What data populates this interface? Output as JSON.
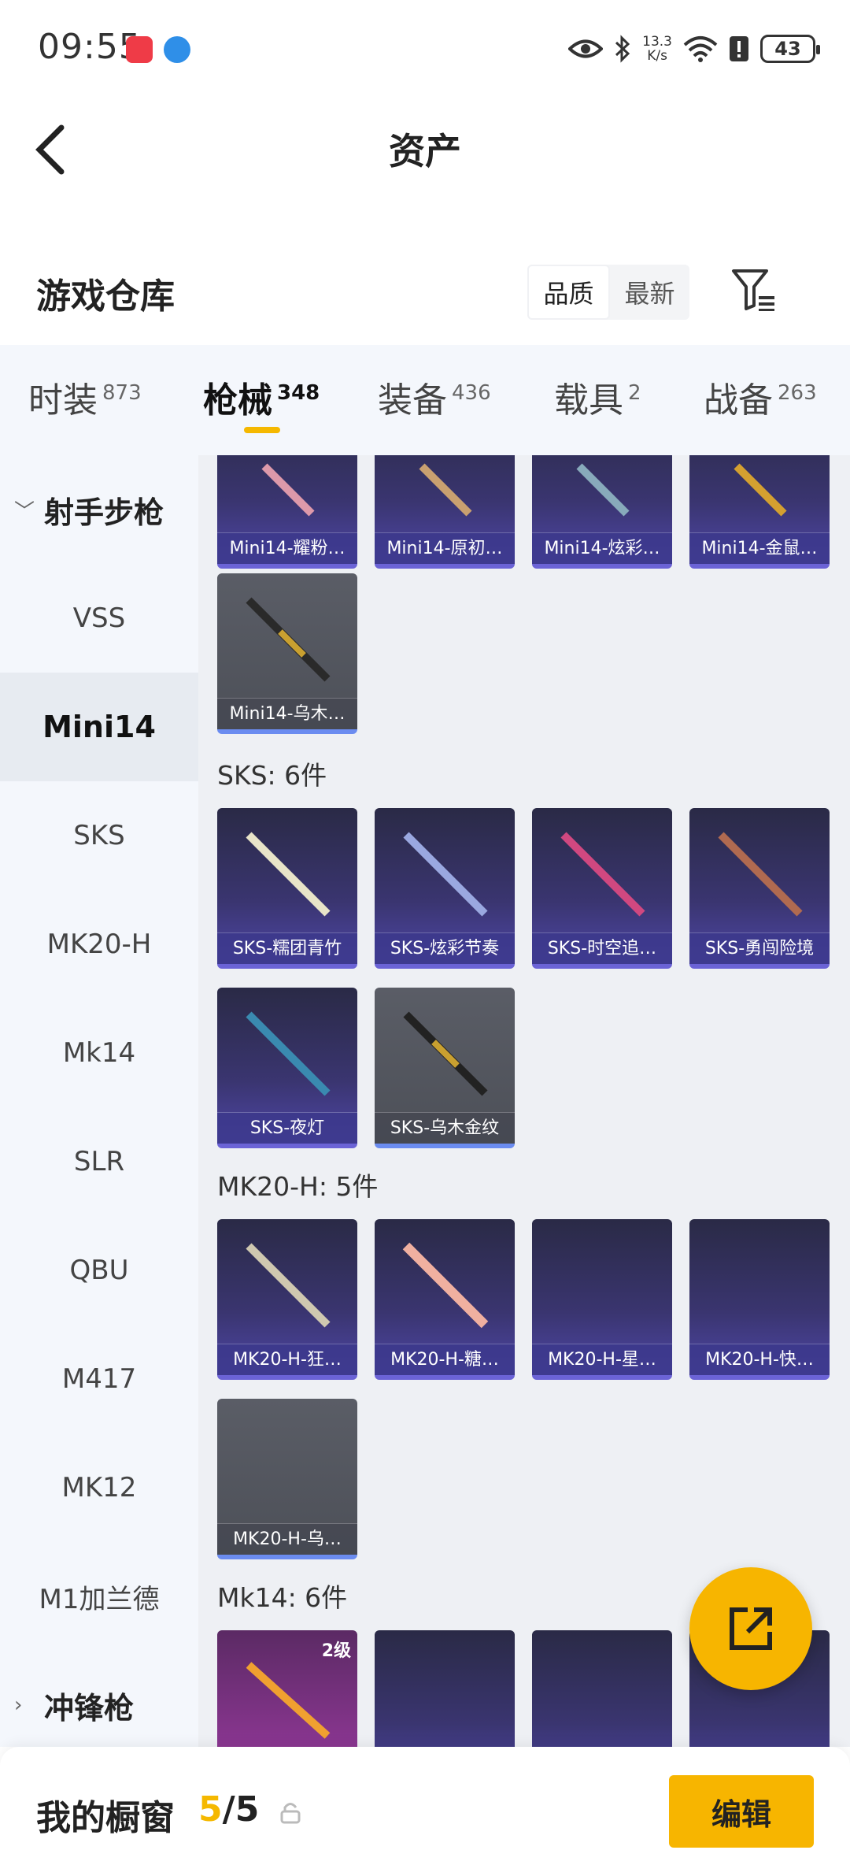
{
  "status": {
    "time": "09:55",
    "speed": "13.3\nK/s",
    "battery": "43"
  },
  "header": {
    "title": "资产"
  },
  "warehouse": {
    "title": "游戏仓库",
    "sort_quality": "品质",
    "sort_latest": "最新"
  },
  "tabs": [
    {
      "label": "时装",
      "count": "873"
    },
    {
      "label": "枪械",
      "count": "348"
    },
    {
      "label": "装备",
      "count": "436"
    },
    {
      "label": "载具",
      "count": "2"
    },
    {
      "label": "战备",
      "count": "263"
    }
  ],
  "categories": [
    "射手步枪",
    "VSS",
    "Mini14",
    "SKS",
    "MK20-H",
    "Mk14",
    "SLR",
    "QBU",
    "M417",
    "MK12",
    "M1加兰德",
    "冲锋枪"
  ],
  "sections": {
    "mini14_items": [
      "Mini14-耀粉…",
      "Mini14-原初…",
      "Mini14-炫彩…",
      "Mini14-金鼠…",
      "Mini14-乌木…"
    ],
    "sks": {
      "title": "SKS: 6件",
      "items": [
        "SKS-糯团青竹",
        "SKS-炫彩节奏",
        "SKS-时空追…",
        "SKS-勇闯险境",
        "SKS-夜灯",
        "SKS-乌木金纹"
      ]
    },
    "mk20h": {
      "title": "MK20-H: 5件",
      "items": [
        "MK20-H-狂…",
        "MK20-H-糖…",
        "MK20-H-星…",
        "MK20-H-快…",
        "MK20-H-乌…"
      ]
    },
    "mk14": {
      "title": "Mk14: 6件",
      "badge": "2级"
    }
  },
  "bottom": {
    "my_window": "我的橱窗",
    "count_n": "5",
    "count_total": "/5",
    "edit": "编辑"
  },
  "colors": {
    "accent": "#f7b500",
    "card_purple": "#4e46a6"
  }
}
